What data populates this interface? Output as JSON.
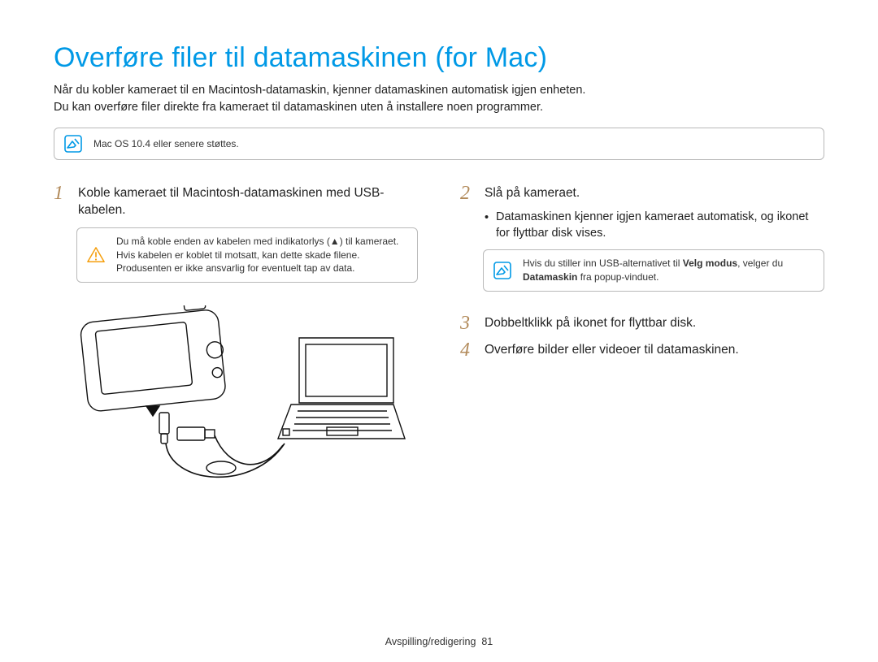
{
  "title": "Overføre filer til datamaskinen (for Mac)",
  "intro_line1": "Når du kobler kameraet til en Macintosh-datamaskin, kjenner datamaskinen automatisk igjen enheten.",
  "intro_line2": "Du kan overføre filer direkte fra kameraet til datamaskinen uten å installere noen programmer.",
  "top_notice": "Mac OS 10.4 eller senere støttes.",
  "left": {
    "step1_num": "1",
    "step1_text": "Koble kameraet til Macintosh-datamaskinen med USB-kabelen.",
    "warning": "Du må koble enden av kabelen med indikatorlys (▲) til kameraet. Hvis kabelen er koblet til motsatt, kan dette skade filene. Produsenten er ikke ansvarlig for eventuelt tap av data."
  },
  "right": {
    "step2_num": "2",
    "step2_text": "Slå på kameraet.",
    "bullet": "Datamaskinen kjenner igjen kameraet automatisk, og ikonet for flyttbar disk vises.",
    "notice_pre": "Hvis du stiller inn USB-alternativet til ",
    "notice_b1": "Velg modus",
    "notice_mid": ", velger du ",
    "notice_b2": "Datamaskin",
    "notice_post": " fra popup-vinduet.",
    "step3_num": "3",
    "step3_text": "Dobbeltklikk på ikonet for flyttbar disk.",
    "step4_num": "4",
    "step4_text": "Overføre bilder eller videoer til datamaskinen."
  },
  "footer_label": "Avspilling/redigering",
  "footer_page": "81"
}
